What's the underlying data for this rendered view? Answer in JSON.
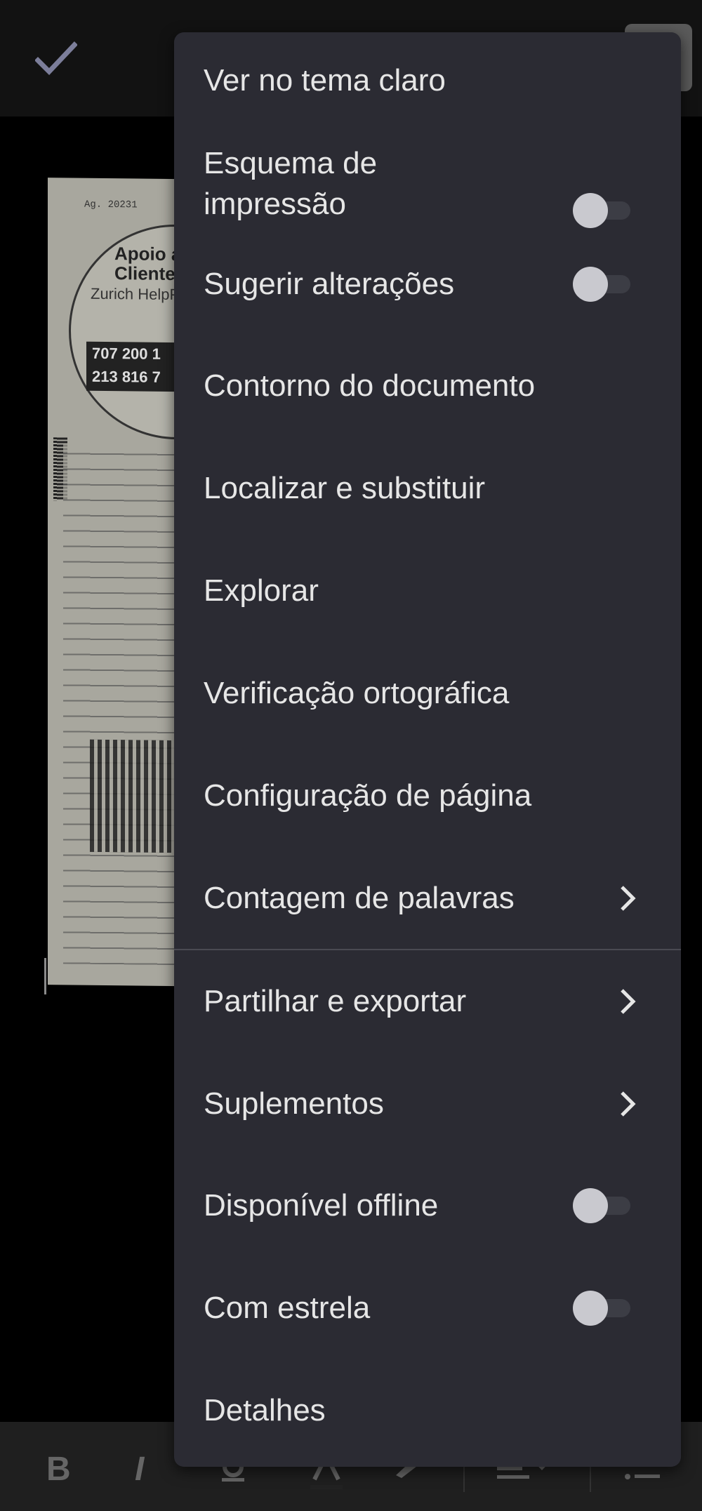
{
  "toolbar": {
    "done_icon": "check-icon"
  },
  "document": {
    "header_code": "Ag. 20231",
    "circle_title": "Apoio a\nCliente",
    "circle_subtitle": "Zurich HelpP",
    "circle_numbers": "707 200 1\n213 816 7"
  },
  "menu": {
    "items": [
      {
        "label": "Ver no tema claro",
        "control": "none"
      },
      {
        "label": "Esquema de\nimpressão",
        "control": "toggle",
        "on": false
      },
      {
        "label": "Sugerir alterações",
        "control": "toggle",
        "on": false
      },
      {
        "label": "Contorno do documento",
        "control": "none"
      },
      {
        "label": "Localizar e substituir",
        "control": "none"
      },
      {
        "label": "Explorar",
        "control": "none"
      },
      {
        "label": "Verificação ortográfica",
        "control": "none"
      },
      {
        "label": "Configuração de página",
        "control": "none"
      },
      {
        "label": "Contagem de palavras",
        "control": "chevron"
      },
      {
        "label": "Partilhar e exportar",
        "control": "chevron"
      },
      {
        "label": "Suplementos",
        "control": "chevron"
      },
      {
        "label": "Disponível offline",
        "control": "toggle",
        "on": false
      },
      {
        "label": "Com estrela",
        "control": "toggle",
        "on": false
      },
      {
        "label": "Detalhes",
        "control": "none"
      }
    ]
  },
  "formatting": {
    "bold": "B",
    "italic": "I"
  },
  "colors": {
    "menu_background": "#2b2b33",
    "menu_text": "#e6e6e6",
    "toggle_thumb_off": "#c9c9cf",
    "toggle_track_off": "#3c3d45"
  }
}
